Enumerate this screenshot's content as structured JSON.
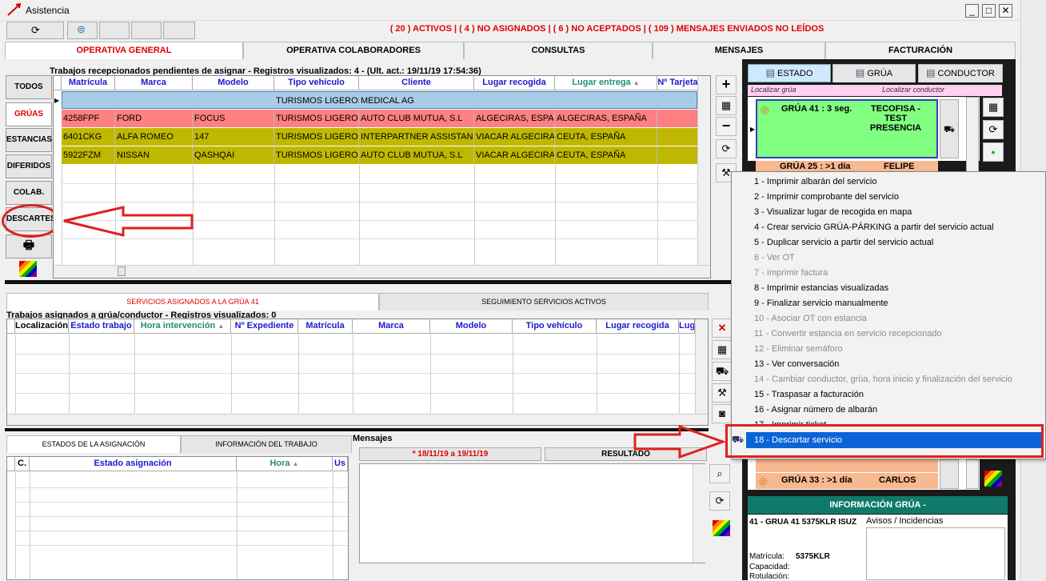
{
  "window": {
    "title": "Asistencia",
    "min": "_",
    "max": "□",
    "close": "✕"
  },
  "status_text": "( 20 ) ACTIVOS | ( 4 ) NO ASIGNADOS | ( 6 ) NO ACEPTADOS | ( 109 ) MENSAJES ENVIADOS NO LEÍDOS",
  "tabs": [
    "OPERATIVA GENERAL",
    "OPERATIVA COLABORADORES",
    "CONSULTAS",
    "MENSAJES",
    "FACTURACIÓN"
  ],
  "pending": {
    "title": "Trabajos recepcionados pendientes de asignar - Registros visualizados: 4 - (Ult. act.: 19/11/19 17:54:36)",
    "columns": [
      "Matrícula",
      "Marca",
      "Modelo",
      "Tipo vehículo",
      "Cliente",
      "Lugar recogida",
      "Lugar entrega",
      "Nº Tarjeta"
    ],
    "rows": [
      [
        "",
        "",
        "",
        "TURISMOS LIGEROS",
        "MEDICAL AG",
        "",
        "",
        ""
      ],
      [
        "4258FPF",
        "FORD",
        "FOCUS",
        "TURISMOS LIGEROS",
        "AUTO CLUB MUTUA, S.L",
        "ALGECIRAS, ESPAÑ",
        "ALGECIRAS, ESPAÑA",
        ""
      ],
      [
        "6401CKG",
        "ALFA ROMEO",
        "147",
        "TURISMOS LIGEROS",
        "INTERPARTNER ASSISTANC",
        "VIACAR ALGECIRAS",
        "CEUTA, ESPAÑA",
        ""
      ],
      [
        "5922FZM",
        "NISSAN",
        "QASHQAI",
        "TURISMOS LIGEROS",
        "AUTO CLUB MUTUA, S.L",
        "VIACAR ALGECIRAS",
        "CEUTA, ESPAÑA",
        ""
      ]
    ],
    "row_colors": [
      "#a8cce8",
      "#ff8080",
      "#c0b800",
      "#c0b800"
    ]
  },
  "sidebar": [
    "TODOS",
    "GRÚAS",
    "ESTANCIAS",
    "DIFERIDOS",
    "COLAB.",
    "DESCARTES"
  ],
  "assigned_tabs": [
    "SERVICIOS ASIGNADOS A LA GRÚA 41",
    "SEGUIMIENTO SERVICIOS ACTIVOS"
  ],
  "assigned": {
    "title": "Trabajos asignados a grúa/conductor - Registros visualizados: 0",
    "columns": [
      "Localización",
      "Estado trabajo",
      "Hora intervención",
      "Nº Expediente",
      "Matrícula",
      "Marca",
      "Modelo",
      "Tipo vehículo",
      "Lugar recogida",
      "Lug"
    ]
  },
  "bottom_tabs": [
    "ESTADOS DE LA ASIGNACIÓN",
    "INFORMACIÓN DEL TRABAJO"
  ],
  "states_columns": [
    "C.",
    "Estado asignación",
    "Hora",
    "Us"
  ],
  "messages": {
    "title": "Mensajes",
    "date_range": "* 18/11/19 a 19/11/19",
    "result": "RESULTADO"
  },
  "right": {
    "tabs": [
      "ESTADO",
      "GRÚA",
      "CONDUCTOR"
    ],
    "localizar_grua": "Localizar grúa",
    "localizar_conductor": "Localizar conductor",
    "cards": [
      {
        "left": "GRÚA 41 : 3 seg.",
        "right": "TECOFISA - TEST PRESENCIA",
        "color": "#80ff80"
      },
      {
        "left": "GRÚA 25 : >1 día",
        "right": "FELIPE",
        "color": "#f8b890"
      },
      {
        "left": "GRÚA 33 : >1 día",
        "right": "CARLOS",
        "color": "#f8b890"
      }
    ],
    "info_header": "INFORMACIÓN GRÚA -",
    "info_line": "41 - GRUA 41 5375KLR ISUZ",
    "avisos": "Avisos / Incidencias",
    "matricula_label": "Matrícula:",
    "matricula_value": "5375KLR",
    "capacidad_label": "Capacidad:",
    "rotulacion_label": "Rotulación:"
  },
  "context_menu": [
    {
      "label": "1 - Imprimir albarán del servicio",
      "enabled": true
    },
    {
      "label": "2 - Imprimir comprobante del servicio",
      "enabled": true
    },
    {
      "label": "3 - Visualizar lugar de recogida en mapa",
      "enabled": true
    },
    {
      "label": "4 - Crear servicio GRÚA-PÁRKING a partir del servicio actual",
      "enabled": true
    },
    {
      "label": "5 - Duplicar servicio a partir del servicio actual",
      "enabled": true
    },
    {
      "label": "6 - Ver OT",
      "enabled": false
    },
    {
      "label": "7 - Imprimir factura",
      "enabled": false
    },
    {
      "label": "8 - Imprimir estancias visualizadas",
      "enabled": true
    },
    {
      "label": "9 - Finalizar servicio manualmente",
      "enabled": true
    },
    {
      "label": "10 - Asociar OT con estancia",
      "enabled": false
    },
    {
      "label": "11 - Convertir estancia en servicio recepcionado",
      "enabled": false
    },
    {
      "label": "12 - Eliminar semáforo",
      "enabled": false
    },
    {
      "label": "13 - Ver conversación",
      "enabled": true
    },
    {
      "label": "14 - Cambiar conductor, grúa, hora inicio y finalización del servicio",
      "enabled": false
    },
    {
      "label": "15 - Traspasar a facturación",
      "enabled": true
    },
    {
      "label": "16 - Asignar número de albarán",
      "enabled": true
    },
    {
      "label": "17 - Imprimir ticket",
      "enabled": true
    },
    {
      "label": "18 - Descartar servicio",
      "enabled": true,
      "selected": true
    }
  ]
}
